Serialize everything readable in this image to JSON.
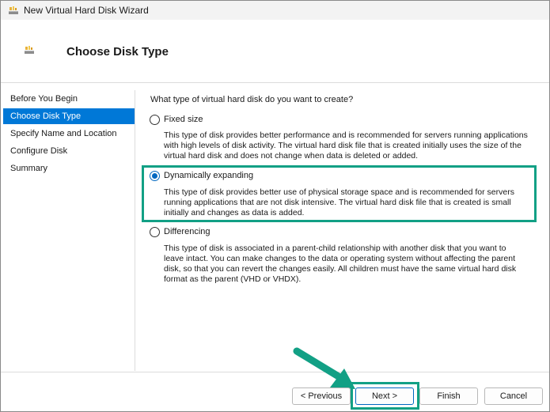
{
  "window": {
    "title": "New Virtual Hard Disk Wizard",
    "header_title": "Choose Disk Type"
  },
  "sidebar": {
    "items": [
      {
        "label": "Before You Begin"
      },
      {
        "label": "Choose Disk Type",
        "active": true
      },
      {
        "label": "Specify Name and Location"
      },
      {
        "label": "Configure Disk"
      },
      {
        "label": "Summary"
      }
    ]
  },
  "main": {
    "question": "What type of virtual hard disk do you want to create?",
    "options": [
      {
        "label": "Fixed size",
        "selected": false,
        "description_lines": [
          "This type of disk provides better performance and is recommended for servers running applications",
          "with high levels of disk activity. The virtual hard disk file that is created initially uses the size of the",
          "virtual hard disk and does not change when data is deleted or added."
        ]
      },
      {
        "label": "Dynamically expanding",
        "selected": true,
        "description_lines": [
          "This type of disk provides better use of physical storage space and is recommended for servers",
          "running applications that are not disk intensive. The virtual hard disk file that is created is small",
          "initially and changes as data is added."
        ]
      },
      {
        "label": "Differencing",
        "selected": false,
        "description_lines": [
          "This type of disk is associated in a parent-child relationship with another disk that you want to",
          "leave intact. You can make changes to the data or operating system without affecting the parent",
          "disk, so that you can revert the changes easily. All children must have the same virtual hard disk",
          "format as the parent (VHD or VHDX)."
        ]
      }
    ]
  },
  "footer": {
    "previous_label": "< Previous",
    "next_label": "Next >",
    "finish_label": "Finish",
    "cancel_label": "Cancel"
  },
  "colors": {
    "accent": "#0078d7",
    "highlight": "#12a085"
  },
  "icons": {
    "app": "hard-disk-icon"
  }
}
